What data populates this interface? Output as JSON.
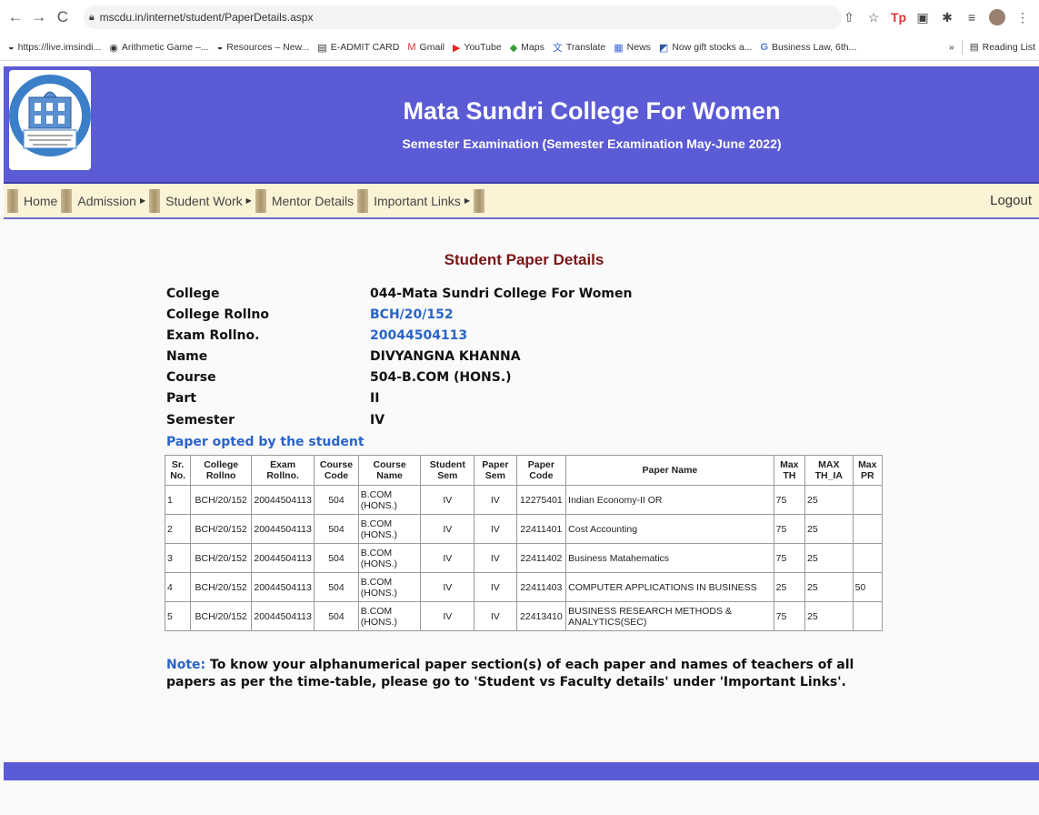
{
  "browser": {
    "url": "mscdu.in/internet/student/PaperDetails.aspx",
    "bookmarks": [
      {
        "label": "https://live.imsindi..."
      },
      {
        "label": "Arithmetic Game –..."
      },
      {
        "label": "Resources – New..."
      },
      {
        "label": "E-ADMIT CARD"
      },
      {
        "label": "Gmail"
      },
      {
        "label": "YouTube"
      },
      {
        "label": "Maps"
      },
      {
        "label": "Translate"
      },
      {
        "label": "News"
      },
      {
        "label": "Now gift stocks a..."
      },
      {
        "label": "Business Law, 6th..."
      }
    ],
    "more_bookmarks": "»",
    "reading_list": "Reading List"
  },
  "header": {
    "title": "Mata Sundri College For Women",
    "subtitle": "Semester Examination (Semester Examination May-June 2022)"
  },
  "menu": {
    "items": [
      "Home",
      "Admission",
      "Student Work",
      "Mentor Details",
      "Important Links"
    ],
    "logout": "Logout"
  },
  "page": {
    "heading": "Student Paper Details"
  },
  "student": {
    "fields": [
      {
        "label": "College",
        "value": "044-Mata Sundri College For Women"
      },
      {
        "label": "College Rollno",
        "value": "BCH/20/152"
      },
      {
        "label": "Exam Rollno.",
        "value": "20044504113"
      },
      {
        "label": "Name",
        "value": "DIVYANGNA KHANNA"
      },
      {
        "label": "Course",
        "value": "504-B.COM (HONS.)"
      },
      {
        "label": "Part",
        "value": "II"
      },
      {
        "label": "Semester",
        "value": "IV"
      }
    ]
  },
  "papers": {
    "section_title": "Paper opted by the student",
    "headers": [
      "Sr.\nNo.",
      "College\nRollno",
      "Exam\nRollno.",
      "Course\nCode",
      "Course Name",
      "Student\nSem",
      "Paper\nSem",
      "Paper\nCode",
      "Paper Name",
      "Max\nTH",
      "MAX\nTH_IA",
      "Max\nPR"
    ],
    "rows": [
      [
        "1",
        "BCH/20/152",
        "20044504113",
        "504",
        "B.COM (HONS.)",
        "IV",
        "IV",
        "12275401",
        "Indian Economy-II OR",
        "75",
        "25",
        ""
      ],
      [
        "2",
        "BCH/20/152",
        "20044504113",
        "504",
        "B.COM (HONS.)",
        "IV",
        "IV",
        "22411401",
        "Cost Accounting",
        "75",
        "25",
        ""
      ],
      [
        "3",
        "BCH/20/152",
        "20044504113",
        "504",
        "B.COM (HONS.)",
        "IV",
        "IV",
        "22411402",
        "Business Matahematics",
        "75",
        "25",
        ""
      ],
      [
        "4",
        "BCH/20/152",
        "20044504113",
        "504",
        "B.COM (HONS.)",
        "IV",
        "IV",
        "22411403",
        "COMPUTER APPLICATIONS IN BUSINESS",
        "25",
        "25",
        "50"
      ],
      [
        "5",
        "BCH/20/152",
        "20044504113",
        "504",
        "B.COM (HONS.)",
        "IV",
        "IV",
        "22413410",
        "BUSINESS RESEARCH METHODS & ANALYTICS(SEC)",
        "75",
        "25",
        ""
      ]
    ]
  },
  "note": {
    "label": "Note:",
    "text": " To know your alphanumerical paper section(s) of each paper and names of teachers of all papers as per the time-table, please go to 'Student vs Faculty details' under 'Important Links'."
  }
}
